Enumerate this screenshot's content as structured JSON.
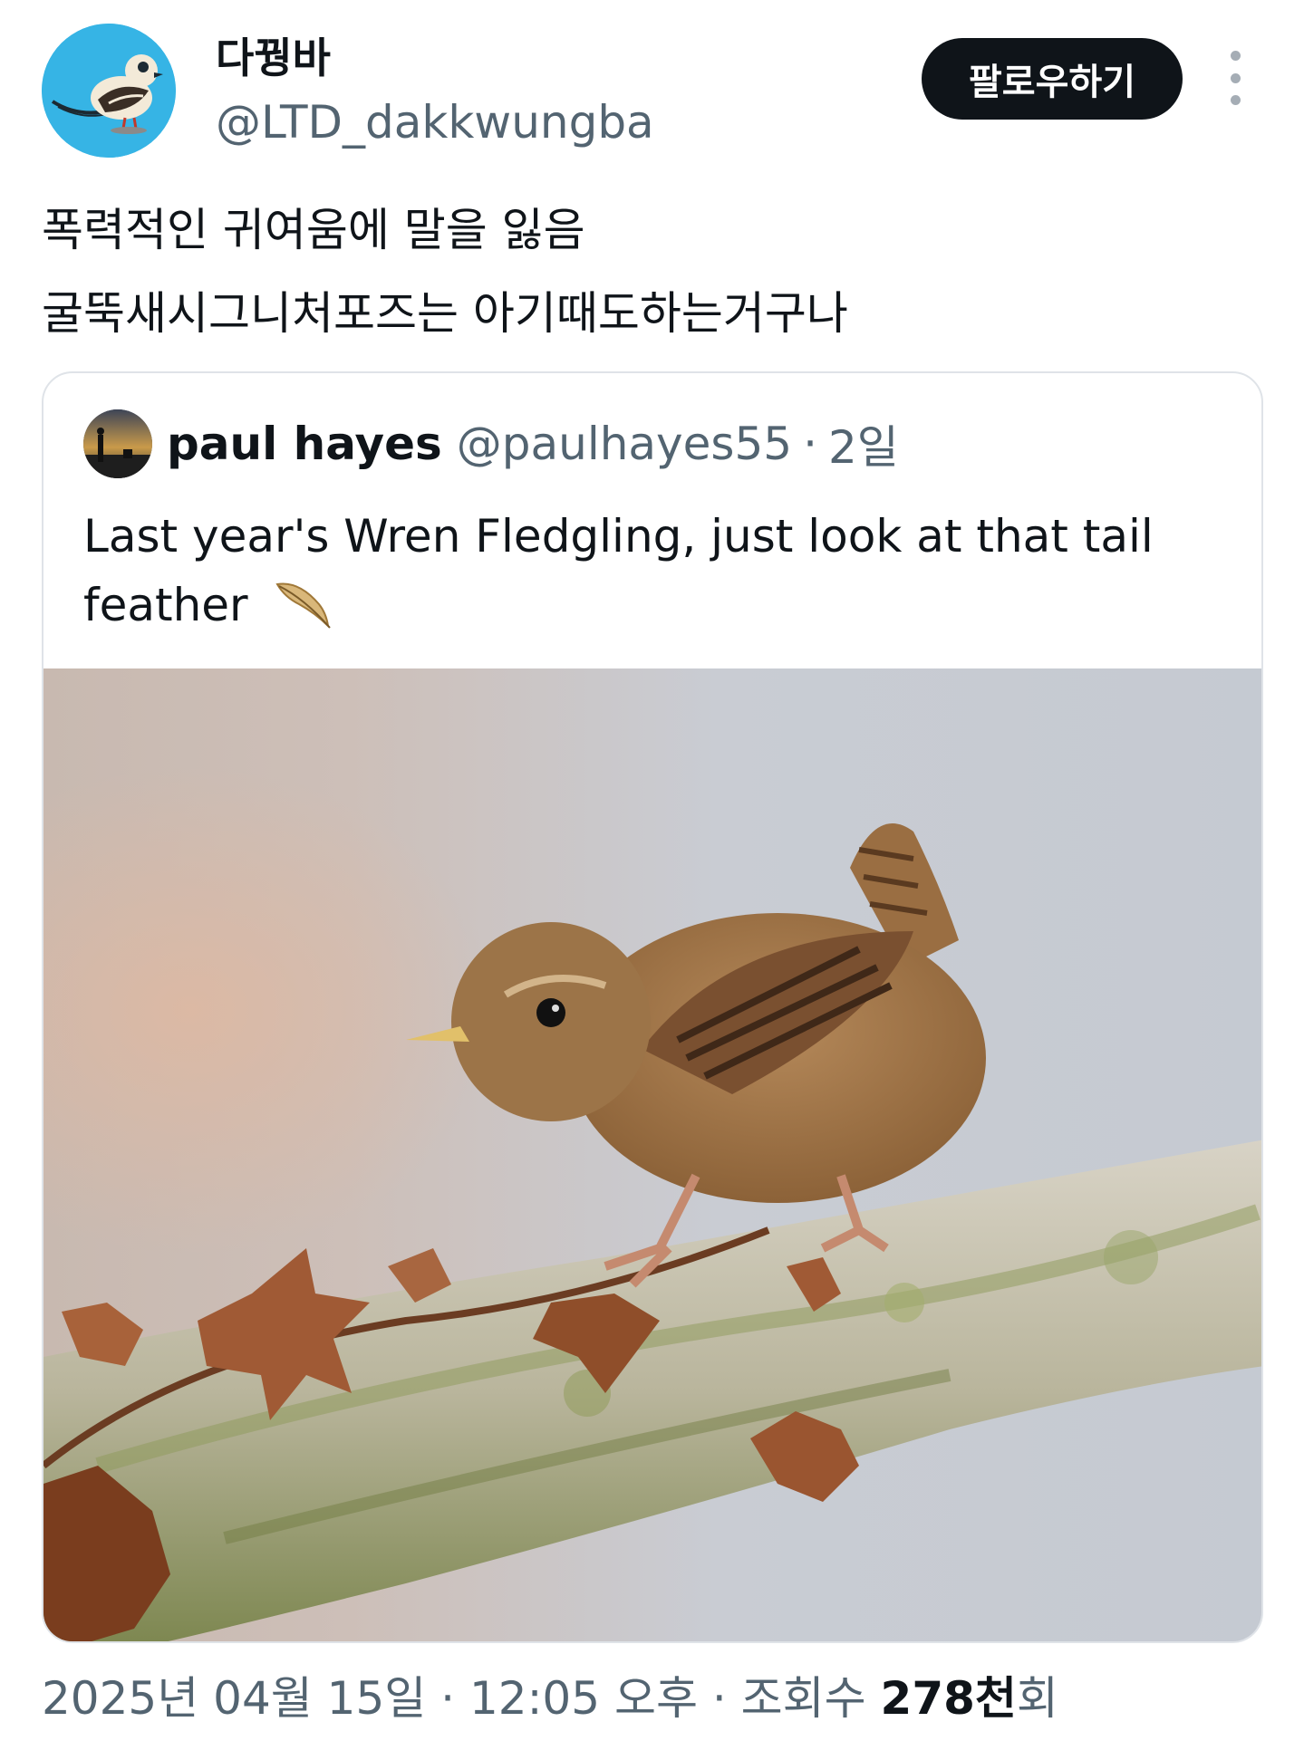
{
  "author": {
    "display_name": "다꿩바",
    "handle": "@LTD_dakkwungba",
    "avatar_icon": "bird-avatar-icon"
  },
  "header": {
    "follow_label": "팔로우하기",
    "more_icon": "more-vertical-icon"
  },
  "tweet": {
    "lines": [
      "폭력적인 귀여움에 말을 잃음",
      "굴뚝새시그니처포즈는 아기때도하는거구나"
    ]
  },
  "quote": {
    "author_name": "paul hayes",
    "author_handle": "@paulhayes55",
    "separator": "·",
    "time": "2일",
    "text": "Last year's Wren Fledgling, just look at that tail feather",
    "emoji_icon": "feather-emoji-icon",
    "image_description_icon": "wren-photo"
  },
  "meta": {
    "date_time": "2025년 04월 15일 · 12:05 오후 · ",
    "views_label_prefix": "조회수 ",
    "views_number": "278천",
    "views_suffix": "회"
  },
  "colors": {
    "avatar_bg": "#36b4e5",
    "button_bg": "#0f1419",
    "secondary_text": "#536471",
    "border": "#dfe3e8"
  }
}
